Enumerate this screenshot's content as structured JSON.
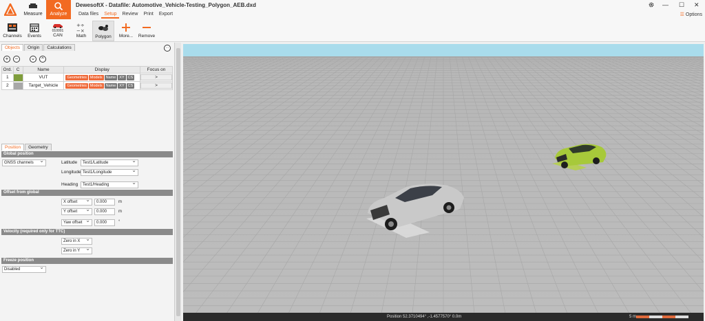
{
  "window": {
    "app_name": "DewesoftX - Datafile: Automotive_Vehicle-Testing_Polygon_AEB.dxd",
    "minimize": "—",
    "maximize": "☐",
    "close": "✕",
    "settings_icon": "gear-icon"
  },
  "modes": {
    "measure": "Measure",
    "analyze": "Analyze"
  },
  "menu_tabs": [
    "Data files",
    "Setup",
    "Review",
    "Print",
    "Export"
  ],
  "options_label": "Options",
  "toolbar": {
    "channels": "Channels",
    "events": "Events",
    "can": "CAN",
    "can_counter": "010001",
    "math": "Math",
    "polygon": "Polygon",
    "more": "More...",
    "remove": "Remove"
  },
  "objects_panel": {
    "tabs": [
      "Objects",
      "Origin",
      "Calculations"
    ],
    "columns": [
      "Ord.",
      "C",
      "Name",
      "Display",
      "Focus on"
    ],
    "rows": [
      {
        "ord": "1",
        "color": "#7f9d3c",
        "name": "VUT",
        "focus": ">"
      },
      {
        "ord": "2",
        "color": "#a8a8a8",
        "name": "Target_Vehicle",
        "focus": ">"
      }
    ],
    "display_chips": [
      "Geometries",
      "Models",
      "Name",
      "XY",
      "CS"
    ],
    "add": "+",
    "remove": "−",
    "down": "⌄",
    "up": "⌃",
    "more": "···"
  },
  "position_panel": {
    "tabs": [
      "Position",
      "Geometry"
    ],
    "global_position": {
      "header": "Global position",
      "source": "GNSS channels",
      "latitude_label": "Latitude",
      "latitude_value": "Test1/Latitude",
      "longitude_label": "Longitude",
      "longitude_value": "Test1/Longitude",
      "heading_label": "Heading",
      "heading_value": "Test1/Heading"
    },
    "offset": {
      "header": "Offset from global",
      "x_label": "X offset",
      "x_value": "0.000",
      "x_unit": "m",
      "y_label": "Y offset",
      "y_value": "0.000",
      "y_unit": "m",
      "yaw_label": "Yaw offset",
      "yaw_value": "0.000",
      "yaw_unit": "°"
    },
    "velocity": {
      "header": "Velocity (required only for TTC)",
      "zero_x": "Zero in X",
      "zero_y": "Zero in Y"
    },
    "freeze": {
      "header": "Freeze position",
      "value": "Disabled"
    }
  },
  "status": {
    "position": "Position 52.3710494° ,-1.4577570° 0.0m",
    "scale": "5 m"
  },
  "colors": {
    "accent": "#f26a21",
    "sky": "#a9dcec",
    "ground": "#bababa",
    "vut_car": "#a7c93a",
    "target_car": "#c9c9c9"
  }
}
